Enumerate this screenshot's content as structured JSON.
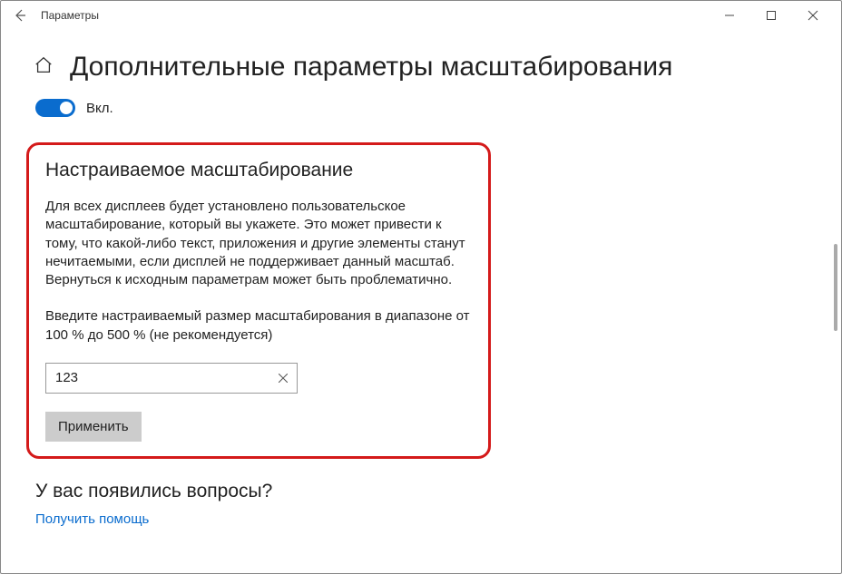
{
  "window": {
    "title": "Параметры"
  },
  "header": {
    "page_title": "Дополнительные параметры масштабирования"
  },
  "toggle": {
    "label": "Вкл.",
    "state": true
  },
  "custom_scaling": {
    "heading": "Настраиваемое масштабирование",
    "description": "Для всех дисплеев будет установлено пользовательское масштабирование, который вы укажете. Это может привести к тому, что какой-либо текст, приложения и другие элементы станут нечитаемыми, если дисплей не поддерживает данный масштаб. Вернуться к исходным параметрам может быть проблематично.",
    "prompt": "Введите настраиваемый размер масштабирования в диапазоне от 100 % до 500 % (не рекомендуется)",
    "input_value": "123",
    "apply_label": "Применить"
  },
  "help": {
    "heading": "У вас появились вопросы?",
    "link_label": "Получить помощь"
  }
}
